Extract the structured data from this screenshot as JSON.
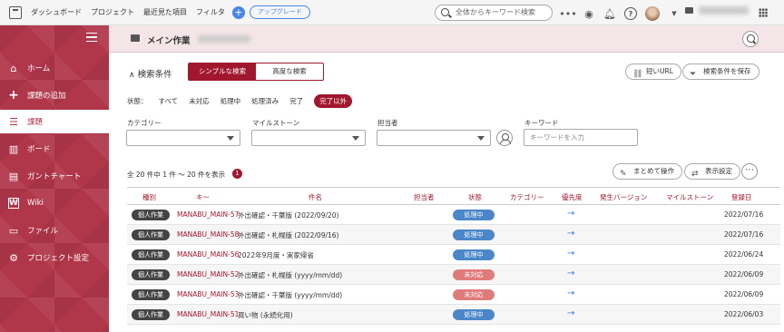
{
  "topbar": {
    "links": [
      "ダッシュボード",
      "プロジェクト",
      "最近見た項目",
      "フィルタ"
    ],
    "upgrade_label": "アップグレード",
    "search_placeholder": "全体からキーワード検索"
  },
  "sidebar": {
    "items": [
      {
        "label": "ホーム",
        "icon": "home-icon"
      },
      {
        "label": "課題の追加",
        "icon": "plus-icon"
      },
      {
        "label": "課題",
        "icon": "list-icon",
        "active": true
      },
      {
        "label": "ボード",
        "icon": "board-icon"
      },
      {
        "label": "ガントチャート",
        "icon": "gantt-icon"
      },
      {
        "label": "Wiki",
        "icon": "wiki-icon"
      },
      {
        "label": "ファイル",
        "icon": "folder-icon"
      },
      {
        "label": "プロジェクト設定",
        "icon": "gear-icon"
      }
    ]
  },
  "header": {
    "title": "メイン作業"
  },
  "search_conditions": {
    "title": "検索条件",
    "simple_label": "シンプルな検索",
    "advanced_label": "高度な検索",
    "short_url_label": "短いURL",
    "save_label": "検索条件を保存",
    "status_label": "状態：",
    "status_options": [
      "すべて",
      "未対応",
      "処理中",
      "処理済み",
      "完了",
      "完了以外"
    ],
    "selected_status": "完了以外",
    "filters": {
      "category": "カテゴリー",
      "milestone": "マイルストーン",
      "assignee": "担当者",
      "keyword": "キーワード",
      "keyword_placeholder": "キーワードを入力"
    }
  },
  "results": {
    "count_text": "全 20 件中 1 件 〜 20 件を表示",
    "badge": "1",
    "bulk_label": "まとめて操作",
    "display_label": "表示設定"
  },
  "table": {
    "columns": [
      "種別",
      "キー",
      "件名",
      "担当者",
      "状態",
      "カテゴリー",
      "優先度",
      "発生バージョン",
      "マイルストーン",
      "登録日"
    ],
    "rows": [
      {
        "type": "個人作業",
        "key": "MANABU_MAIN-57",
        "subject": "外出確認・千葉版 (2022/09/20)",
        "status": "処理中",
        "date": "2022/07/16"
      },
      {
        "type": "個人作業",
        "key": "MANABU_MAIN-58",
        "subject": "外出確認・札幌版 (2022/09/16)",
        "status": "処理中",
        "date": "2022/07/16"
      },
      {
        "type": "個人作業",
        "key": "MANABU_MAIN-56",
        "subject": "2022年9月度・実家帰省",
        "status": "処理中",
        "date": "2022/06/24"
      },
      {
        "type": "個人作業",
        "key": "MANABU_MAIN-52",
        "subject": "外出確認・札幌版 (yyyy/mm/dd)",
        "status": "未対応",
        "date": "2022/06/09"
      },
      {
        "type": "個人作業",
        "key": "MANABU_MAIN-53",
        "subject": "外出確認・千葉版 (yyyy/mm/dd)",
        "status": "未対応",
        "date": "2022/06/09"
      },
      {
        "type": "個人作業",
        "key": "MANABU_MAIN-51",
        "subject": "買い物 (永続化用)",
        "status": "処理中",
        "date": "2022/06/03"
      }
    ]
  },
  "colors": {
    "accent": "#a0172e",
    "sidebar": "#b0364a",
    "in_progress": "#4a86c8",
    "open": "#e07b7b",
    "type_pill": "#444444"
  }
}
